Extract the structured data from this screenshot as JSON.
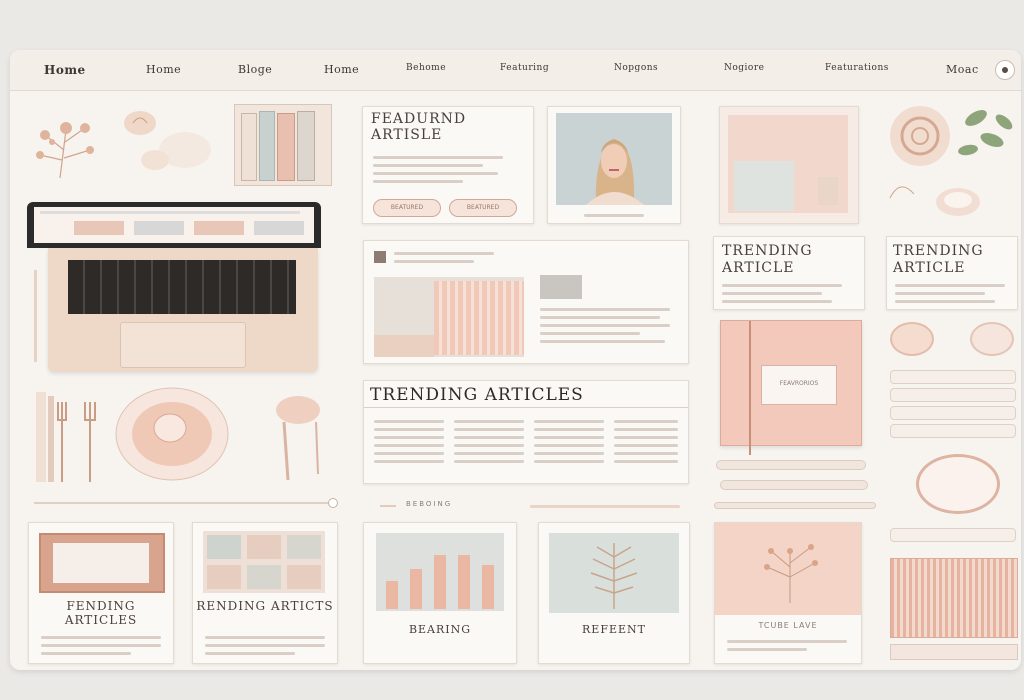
{
  "nav": {
    "items": [
      "Home",
      "Home",
      "Bloge",
      "Home",
      "Behome",
      "Featuring",
      "Nopgons",
      "Nogiore",
      "Featurations",
      "Moac"
    ]
  },
  "featured": {
    "title": "FEADURND ARTISLE",
    "btn1": "BEATURED",
    "btn2": "BEATURED"
  },
  "trending_small_1": "TRENDING ARTICLE",
  "trending_small_2": "TRENDING ARTICLE",
  "trending_main": {
    "title": "TRENDING ARTICLES"
  },
  "notebook_label": "FEAVRORIOS",
  "bottom_cards": [
    {
      "title": "FENDING ARTICLES"
    },
    {
      "title": "RENDING ARTICTS"
    },
    {
      "title": "BEARING"
    },
    {
      "title": "REFEENT"
    },
    {
      "title": "TCUBE LAVE"
    }
  ],
  "divider_text": "BEBOING",
  "colors": {
    "accent": "#e8b8a8",
    "blush": "#f2d6ca",
    "background": "#f7f4f0"
  }
}
